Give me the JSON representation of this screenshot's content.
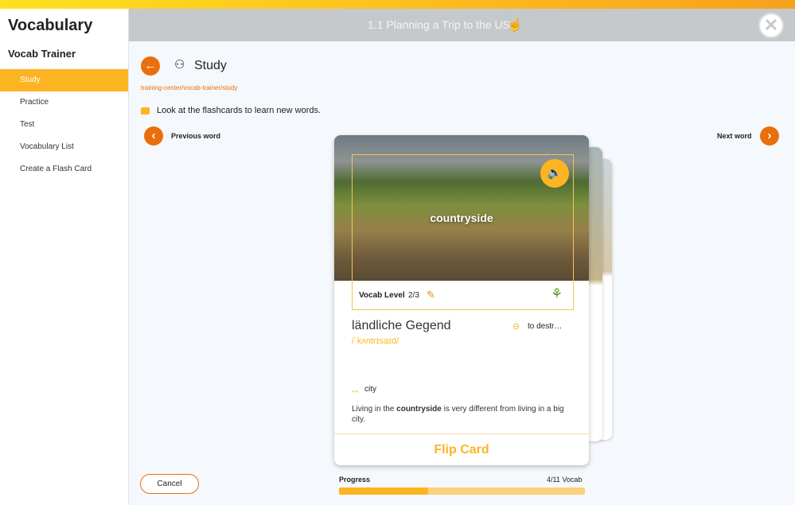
{
  "sidebar": {
    "title": "Vocabulary",
    "subtitle": "Vocab Trainer",
    "items": [
      {
        "label": "Study",
        "active": true
      },
      {
        "label": "Practice"
      },
      {
        "label": "Test"
      },
      {
        "label": "Vocabulary List"
      },
      {
        "label": "Create a Flash Card"
      }
    ]
  },
  "header": {
    "title": "1.1 Planning a Trip to the US",
    "close_icon": "close-icon"
  },
  "page": {
    "title": "Study",
    "breadcrumb": "training-center/vocab-trainer/study",
    "instruction": "Look at the flashcards to learn new words.",
    "previous": "Previous word",
    "next": "Next word",
    "cancel": "Cancel"
  },
  "card": {
    "word": "countryside",
    "level_label": "Vocab Level",
    "level": "2/3",
    "translation": "ländliche Gegend",
    "phonetic": "/ˈkʌntrɪsaɪd/",
    "related": "to destr…",
    "antonym": "city",
    "example_pre": "Living in the ",
    "example_bold": "countryside",
    "example_post": " is very different from living in a big city.",
    "flip": "Flip Card"
  },
  "progress": {
    "label": "Progress",
    "count": "4/11 Vocab",
    "fraction": 0.364
  },
  "colors": {
    "accent": "#fdb422",
    "orange": "#ea6f0c"
  }
}
